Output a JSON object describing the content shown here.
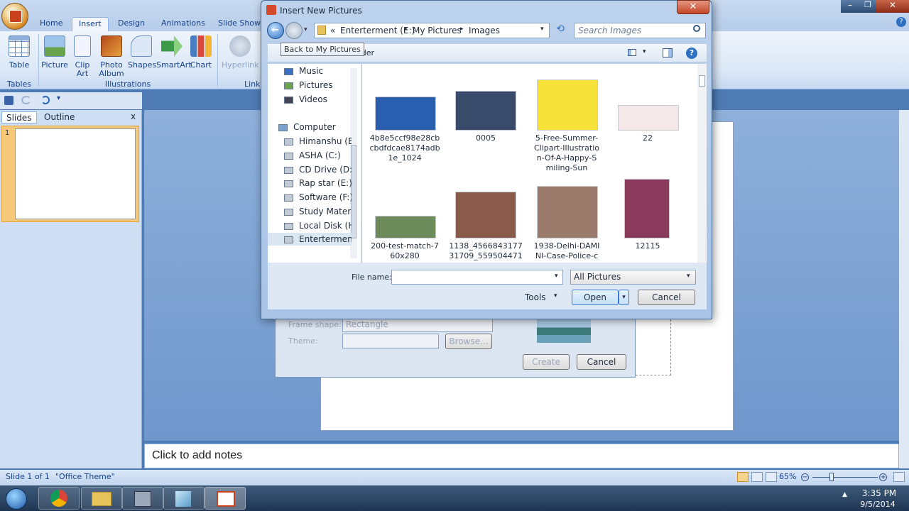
{
  "ribbon": {
    "tabs": [
      "Home",
      "Insert",
      "Design",
      "Animations",
      "Slide Show"
    ],
    "active_tab": "Insert",
    "buttons": {
      "table": "Table",
      "picture": "Picture",
      "clip_art_1": "Clip",
      "clip_art_2": "Art",
      "photo_album_1": "Photo",
      "photo_album_2": "Album",
      "shapes": "Shapes",
      "smartart": "SmartArt",
      "chart": "Chart",
      "hyperlink": "Hyperlink"
    },
    "groups": {
      "tables": "Tables",
      "illustrations": "Illustrations",
      "links": "Links"
    }
  },
  "slides_panel": {
    "tab_slides": "Slides",
    "tab_outline": "Outline",
    "close": "x",
    "slide_number": "1"
  },
  "notes": {
    "placeholder": "Click to add notes"
  },
  "statusbar": {
    "slide_info": "Slide 1 of 1",
    "theme": "\"Office Theme\"",
    "zoom": "65%"
  },
  "taskbar": {
    "time": "3:35 PM",
    "date": "9/5/2014"
  },
  "album_dialog": {
    "frame_shape_label": "Frame shape:",
    "frame_shape_value": "Rectangle",
    "theme_label": "Theme:",
    "browse_button": "Browse...",
    "create_button": "Create",
    "cancel_button": "Cancel"
  },
  "dialog": {
    "title": "Insert New Pictures",
    "tooltip": "Back to My Pictures",
    "new_folder_partial": "older",
    "breadcrumb": {
      "prefix": "«",
      "parts": [
        "Enterterment (E:)",
        "My Pictures",
        "Images"
      ]
    },
    "search_placeholder": "Search Images",
    "nav_items": [
      {
        "label": "Music",
        "icon": "music-icon"
      },
      {
        "label": "Pictures",
        "icon": "pictures-icon"
      },
      {
        "label": "Videos",
        "icon": "videos-icon"
      },
      {
        "label": "Computer",
        "icon": "computer-icon"
      },
      {
        "label": "Himanshu (B:)",
        "icon": "drive-icon"
      },
      {
        "label": "ASHA (C:)",
        "icon": "drive-icon"
      },
      {
        "label": "CD Drive (D:)",
        "icon": "cd-drive-icon"
      },
      {
        "label": "Rap star (E:)",
        "icon": "drive-icon"
      },
      {
        "label": "Software (F:)",
        "icon": "drive-icon"
      },
      {
        "label": "Study Material",
        "icon": "drive-icon"
      },
      {
        "label": "Local Disk (H:)",
        "icon": "drive-icon"
      },
      {
        "label": "Enterterment (",
        "icon": "drive-icon"
      }
    ],
    "files": [
      {
        "name": "4b8e5ccf98e28cb\ncbdfdcae8174adb\n1e_1024",
        "color": "#2a5fb0"
      },
      {
        "name": "0005",
        "color": "#3a4a6a"
      },
      {
        "name": "5-Free-Summer-\nClipart-Illustratio\nn-Of-A-Happy-S\nmiling-Sun",
        "color": "#f6e23a"
      },
      {
        "name": "22",
        "color": "#f4e8e8"
      },
      {
        "name": "200-test-match-7\n60x280",
        "color": "#6d8a5a"
      },
      {
        "name": "1138_4566843177\n31709_559504471",
        "color": "#8a5a4a"
      },
      {
        "name": "1938-Delhi-DAMI\nNI-Case-Police-c",
        "color": "#9a7a6a"
      },
      {
        "name": "12115",
        "color": "#8a3a5a"
      }
    ],
    "file_name_label": "File name:",
    "file_name_value": "",
    "filter_value": "All Pictures",
    "tools_label": "Tools",
    "open_button": "Open",
    "cancel_button": "Cancel"
  }
}
